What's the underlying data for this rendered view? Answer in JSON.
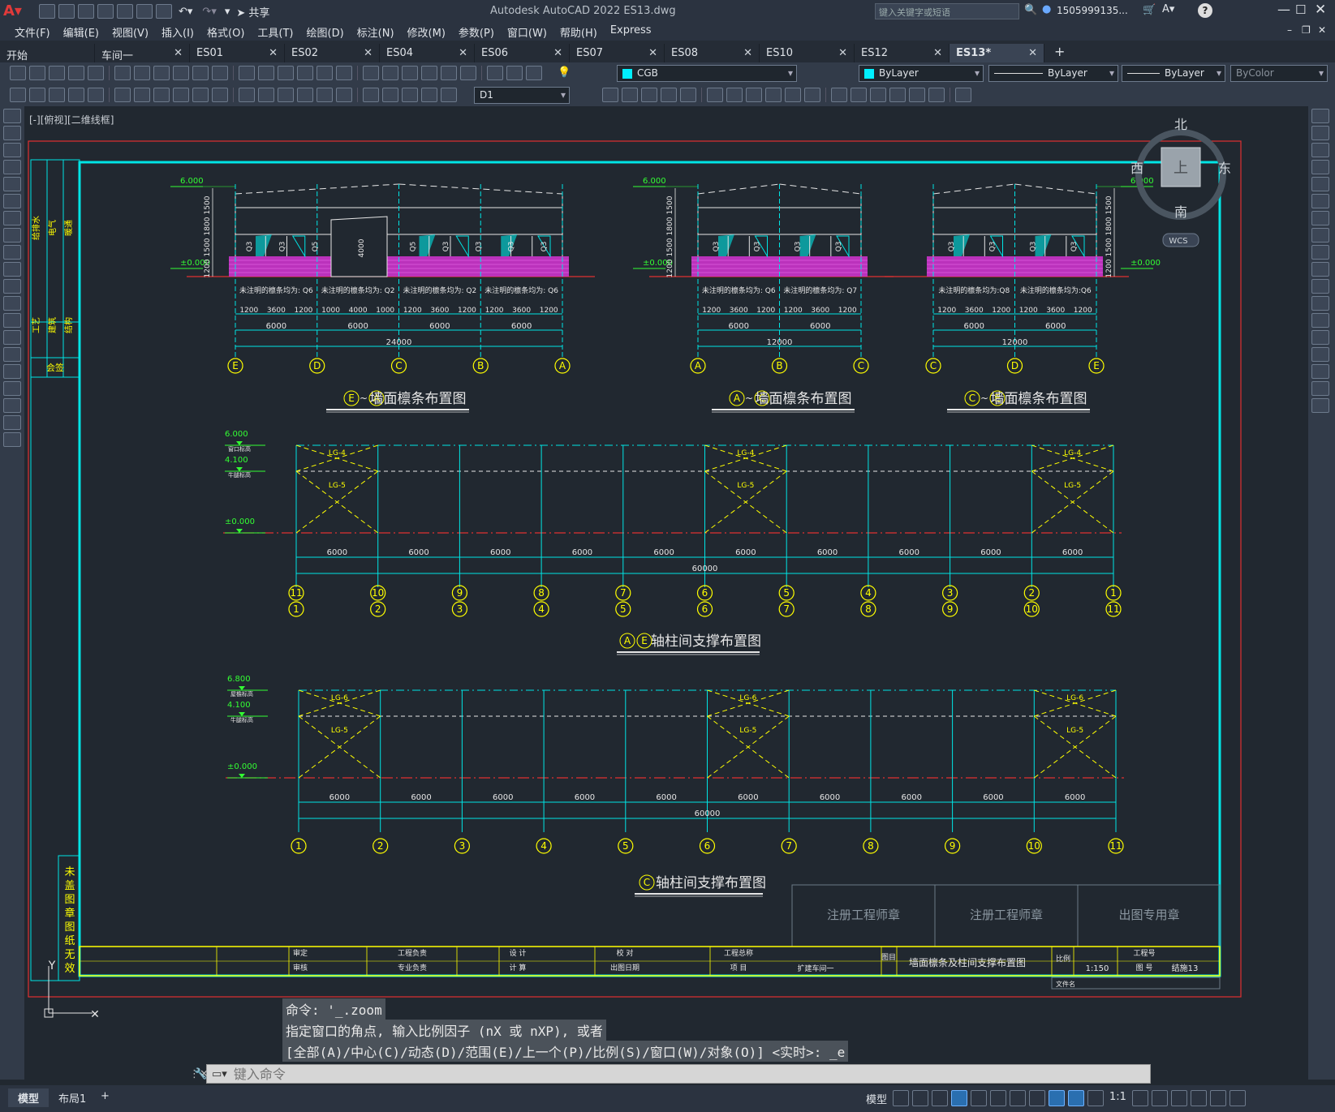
{
  "app": {
    "title": "Autodesk AutoCAD 2022    ES13.dwg",
    "search_placeholder": "键入关键字或短语",
    "user": "1505999135...",
    "share": "共享"
  },
  "menu": [
    "文件(F)",
    "编辑(E)",
    "视图(V)",
    "插入(I)",
    "格式(O)",
    "工具(T)",
    "绘图(D)",
    "标注(N)",
    "修改(M)",
    "参数(P)",
    "窗口(W)",
    "帮助(H)",
    "Express"
  ],
  "tabs": [
    {
      "label": "开始"
    },
    {
      "label": "车间一"
    },
    {
      "label": "ES01"
    },
    {
      "label": "ES02"
    },
    {
      "label": "ES04"
    },
    {
      "label": "ES06"
    },
    {
      "label": "ES07"
    },
    {
      "label": "ES08"
    },
    {
      "label": "ES10"
    },
    {
      "label": "ES12"
    },
    {
      "label": "ES13*",
      "active": true
    }
  ],
  "toolbar": {
    "layer": "CGB",
    "color": "ByLayer",
    "linetype": "ByLayer",
    "lineweight": "ByLayer",
    "plotstyle": "ByColor",
    "dimstyle": "D1"
  },
  "viewport": {
    "label": "[-][俯视][二维线框]"
  },
  "viewcube": {
    "north": "北",
    "south": "南",
    "east": "东",
    "west": "西",
    "top": "上",
    "wcs": "WCS"
  },
  "elevations": {
    "titles": [
      "墙面檩条布置图",
      "墙面檩条布置图",
      "墙面檩条布置图"
    ],
    "title_axes": [
      [
        "E",
        "A"
      ],
      [
        "A",
        "C"
      ],
      [
        "C",
        "E"
      ]
    ],
    "level_6": "6.000",
    "level_0": "±0.000",
    "purlin_notes_1": [
      "未注明的檩条均为: Q6",
      "未注明的檩条均为: Q2",
      "未注明的檩条均为: Q2",
      "未注明的檩条均为: Q6"
    ],
    "purlin_notes_2": [
      "未注明的檩条均为: Q6",
      "未注明的檩条均为: Q7"
    ],
    "purlin_notes_3": [
      "未注明的檩条均为:Q8",
      "未注明的檩条均为:Q6"
    ],
    "axes_1": [
      "E",
      "D",
      "C",
      "B",
      "A"
    ],
    "axes_2": [
      "A",
      "B",
      "C"
    ],
    "axes_3": [
      "C",
      "D",
      "E"
    ],
    "dims_1": [
      "1200",
      "3600",
      "1200",
      "1000",
      "4000",
      "1000",
      "1200",
      "3600",
      "1200",
      "1200",
      "3600",
      "1200"
    ],
    "spans_1": [
      "6000",
      "6000",
      "6000",
      "6000"
    ],
    "total_1": "24000",
    "dims_small": [
      "1200",
      "3600",
      "1200",
      "1200",
      "3600",
      "1200"
    ],
    "spans_2": [
      "6000",
      "6000"
    ],
    "total_2": "12000",
    "vert_dims": [
      "1200",
      "1500",
      "1800",
      "1500"
    ],
    "q_labels": [
      "Q3",
      "Q3",
      "Q5",
      "Q4",
      "Q4",
      "Q5",
      "Q3",
      "Q3",
      "Q3",
      "Q3"
    ],
    "q_4000": "4000"
  },
  "bracing": {
    "title_a": "轴柱间支撑布置图",
    "axes_a": [
      "A",
      "E"
    ],
    "title_c": "轴柱间支撑布置图",
    "axis_c": "C",
    "levels_a": [
      "6.000",
      "4.100",
      "±0.000"
    ],
    "level_notes_a": [
      "窗口标高",
      "牛腿标高"
    ],
    "levels_c": [
      "6.800",
      "4.100",
      "±0.000"
    ],
    "level_notes_c": [
      "屋檐标高",
      "牛腿标高"
    ],
    "spans": [
      "6000",
      "6000",
      "6000",
      "6000",
      "6000",
      "6000",
      "6000",
      "6000",
      "6000",
      "6000"
    ],
    "total": "60000",
    "axes_top": [
      "11",
      "10",
      "9",
      "8",
      "7",
      "6",
      "5",
      "4",
      "3",
      "2",
      "1"
    ],
    "axes_bot": [
      "1",
      "2",
      "3",
      "4",
      "5",
      "6",
      "7",
      "8",
      "9",
      "10",
      "11"
    ],
    "axes_c": [
      "1",
      "2",
      "3",
      "4",
      "5",
      "6",
      "7",
      "8",
      "9",
      "10",
      "11"
    ],
    "lg_top_a": "LG-4",
    "lg_mid": "LG-5",
    "lg_top_c": "LG-6"
  },
  "titleblock": {
    "stamp1": "注册工程师章",
    "stamp2": "注册工程师章",
    "stamp3": "出图专用章",
    "left_vertical": "未盖图章图纸无效",
    "left_col1": [
      "给排水",
      "工艺"
    ],
    "left_col2": [
      "电气",
      "建筑"
    ],
    "left_col3": [
      "暖通",
      "结构"
    ],
    "sign": "会签",
    "cells": [
      "审定",
      "审核",
      "工程负责",
      "专业负责",
      "设 计",
      "计 算",
      "校 对",
      "出图日期",
      "工程总称",
      "项 目",
      "扩建车间一",
      "图目",
      "比例",
      "工程号",
      "图 号"
    ],
    "drawing_name": "墙面檩条及柱间支撑布置图",
    "scale": "1:150",
    "drawing_no": "结施13",
    "file": "文件名"
  },
  "command": {
    "line1": "命令: '_.zoom",
    "line2": "指定窗口的角点, 输入比例因子 (nX 或 nXP), 或者",
    "line3": "[全部(A)/中心(C)/动态(D)/范围(E)/上一个(P)/比例(S)/窗口(W)/对象(O)] <实时>: _e",
    "placeholder": "键入命令"
  },
  "layout_tabs": [
    "模型",
    "布局1"
  ],
  "status": {
    "model": "模型",
    "scale": "1:1"
  },
  "ucs": {
    "y": "Y"
  }
}
